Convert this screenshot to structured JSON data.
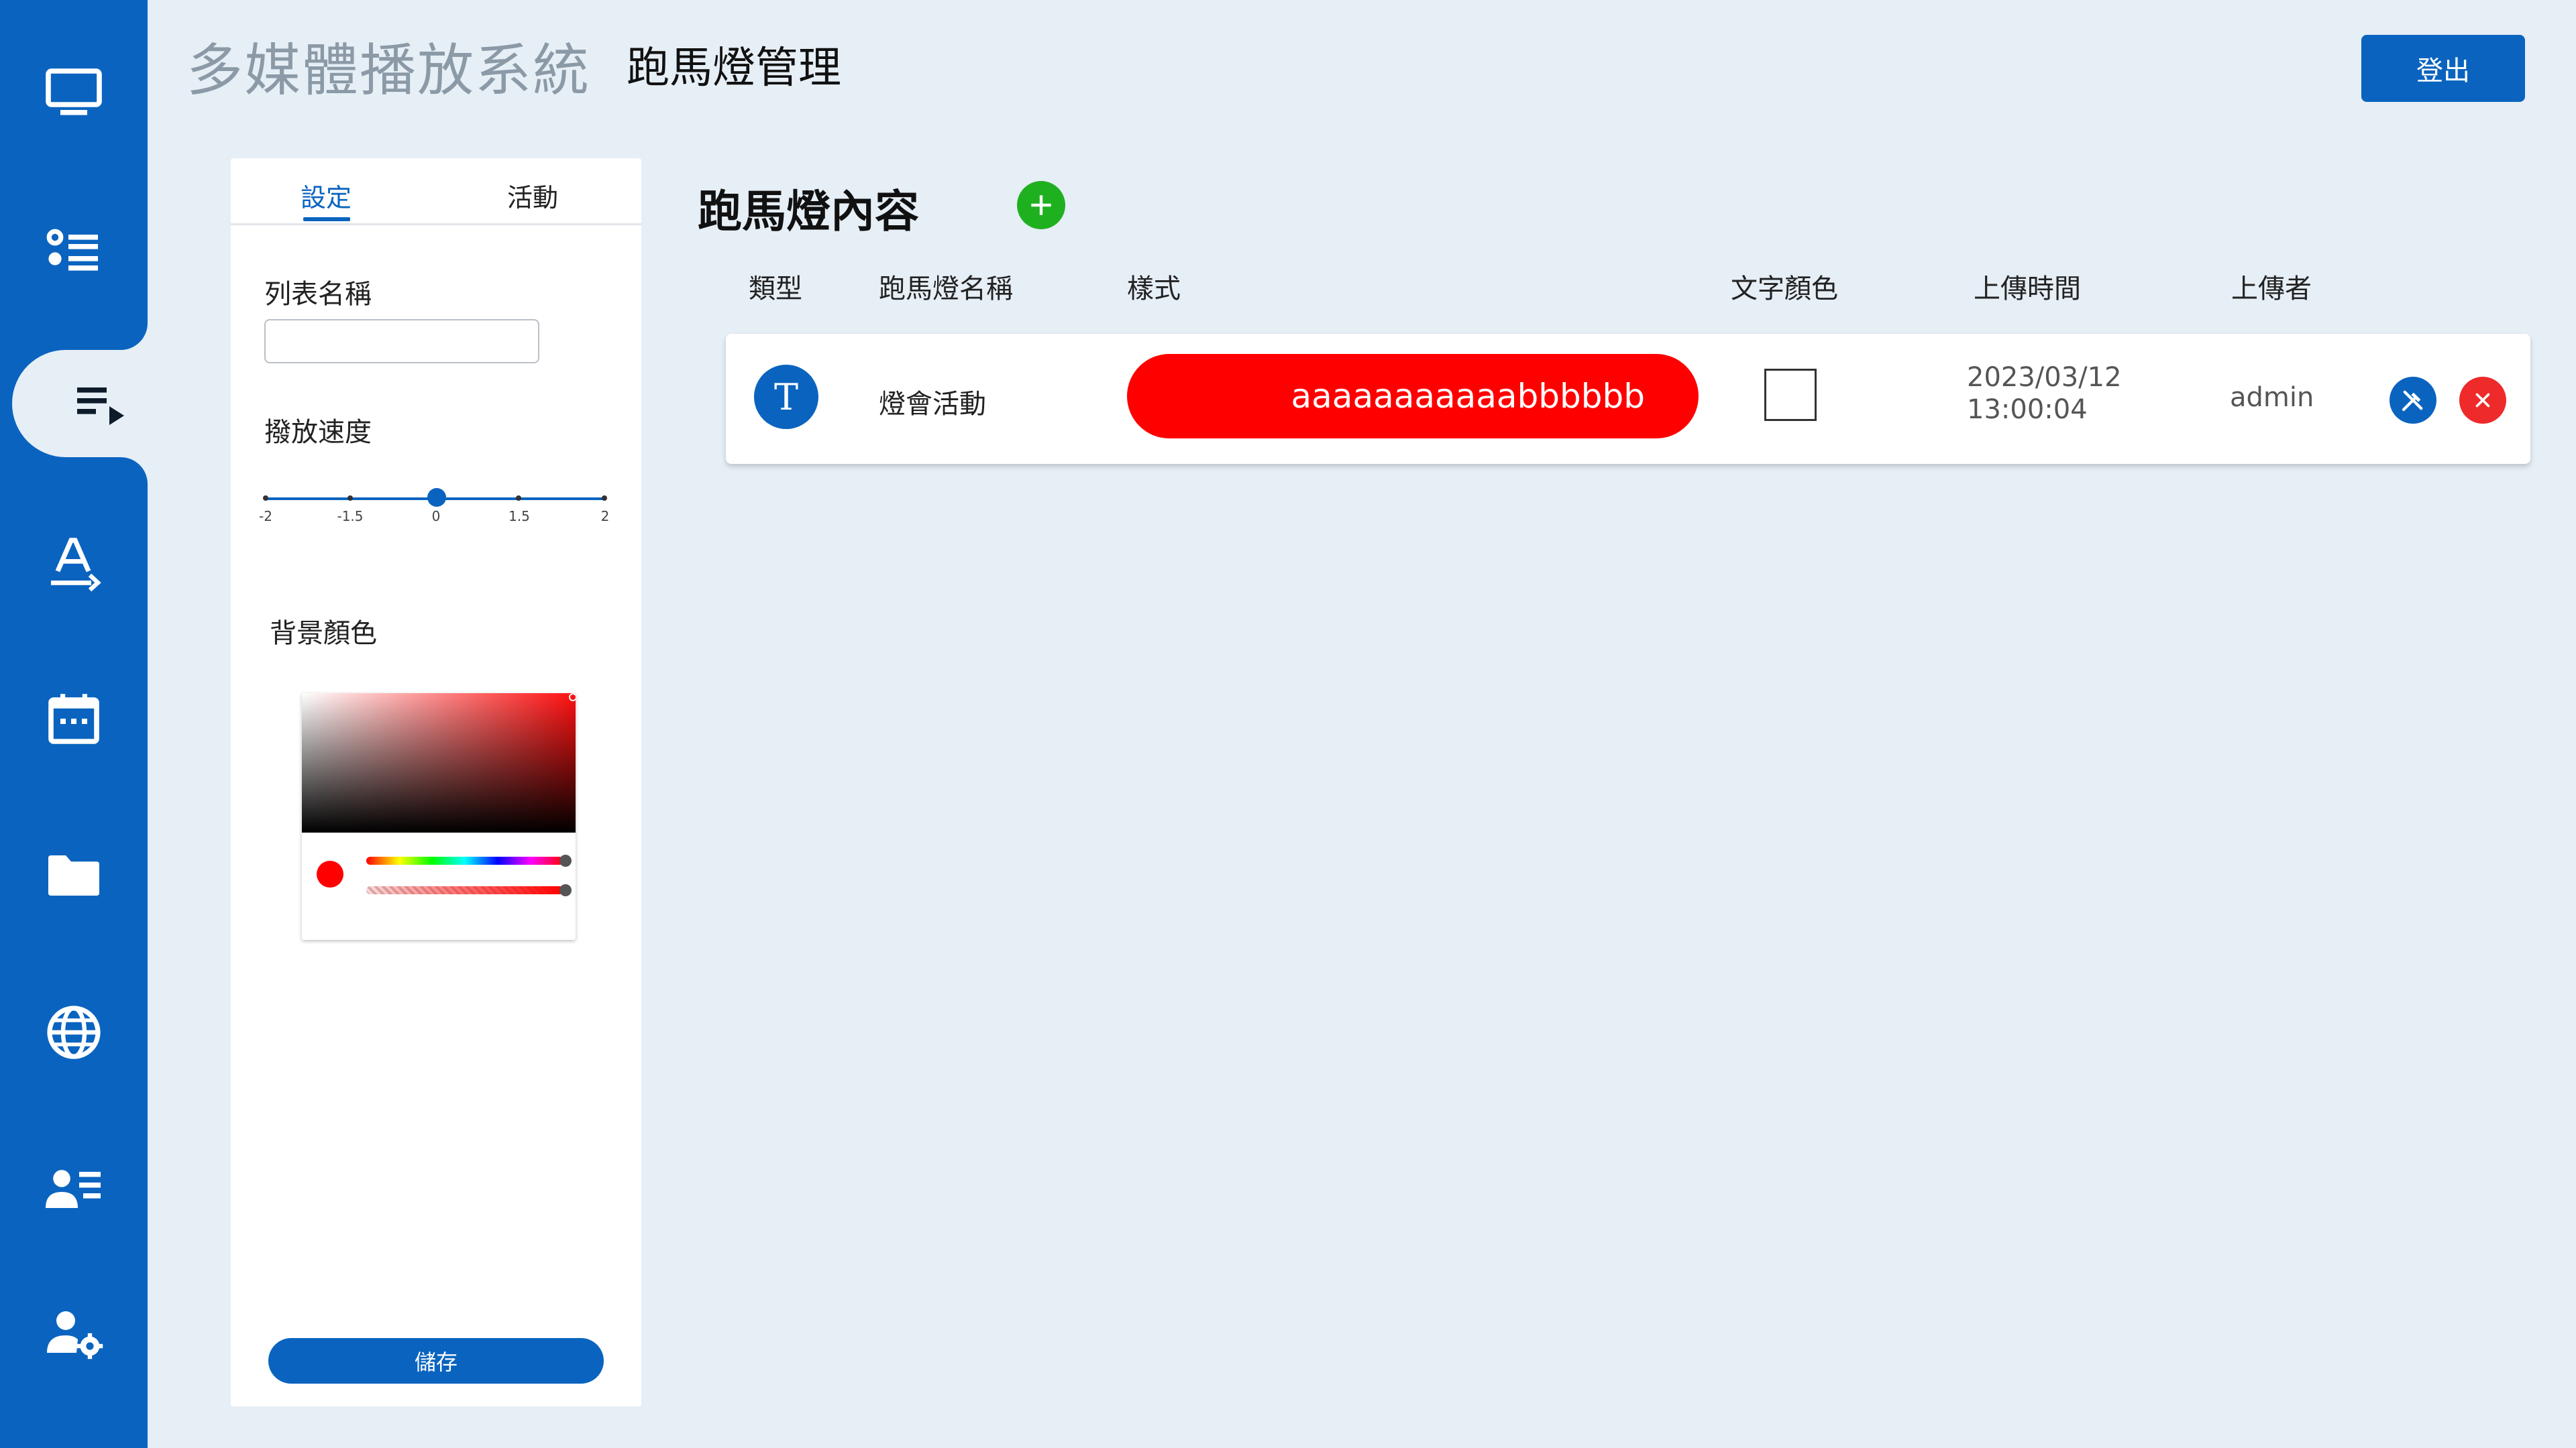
{
  "app": {
    "title": "多媒體播放系統",
    "page_title": "跑馬燈管理",
    "logout_label": "登出"
  },
  "sidebar": {
    "items": [
      {
        "icon": "monitor-icon"
      },
      {
        "icon": "list-icon"
      },
      {
        "icon": "playlist-play-icon",
        "active": true
      },
      {
        "icon": "text-format-icon"
      },
      {
        "icon": "calendar-icon"
      },
      {
        "icon": "folder-icon"
      },
      {
        "icon": "globe-icon"
      },
      {
        "icon": "user-list-icon"
      },
      {
        "icon": "user-settings-icon"
      }
    ]
  },
  "settings": {
    "tabs": [
      {
        "label": "設定",
        "active": true
      },
      {
        "label": "活動"
      }
    ],
    "list_name_label": "列表名稱",
    "list_name_value": "",
    "speed_label": "撥放速度",
    "speed_ticks": [
      "-2",
      "-1.5",
      "0",
      "1.5",
      "2"
    ],
    "speed_value": 0,
    "bg_color_label": "背景顏色",
    "bg_color": "#ff0000",
    "save_label": "儲存"
  },
  "content": {
    "title": "跑馬燈內容",
    "columns": [
      "類型",
      "跑馬燈名稱",
      "樣式",
      "文字顏色",
      "上傳時間",
      "上傳者"
    ],
    "rows": [
      {
        "type_letter": "T",
        "name": "燈會活動",
        "style_text": "aaaaaaaaaaabbbbbb",
        "style_bg": "#ff0000",
        "text_color": "#ffffff",
        "upload_date": "2023/03/12",
        "upload_time": "13:00:04",
        "uploader": "admin"
      }
    ]
  },
  "colors": {
    "primary": "#0a64bf",
    "add": "#1fb01f",
    "delete": "#ee2a2a",
    "background": "#e6eef6"
  }
}
